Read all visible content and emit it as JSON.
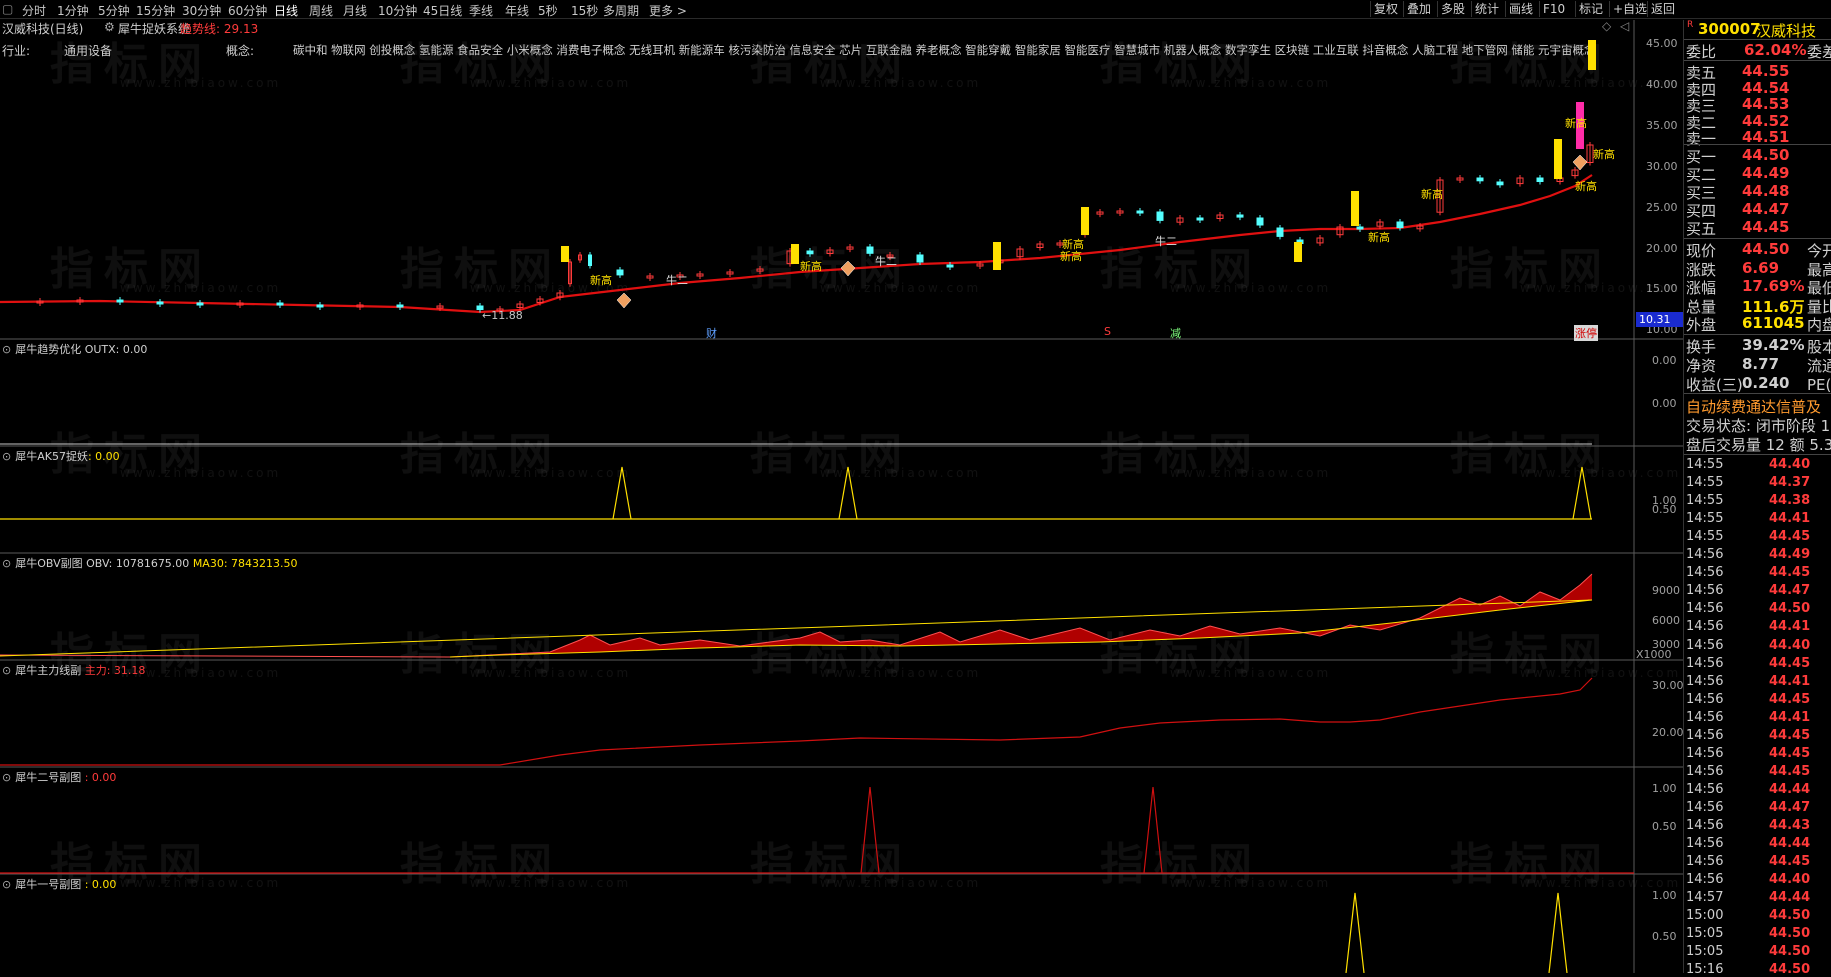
{
  "toolbar": {
    "left_items": [
      "分时",
      "1分钟",
      "5分钟",
      "15分钟",
      "30分钟",
      "60分钟",
      "日线",
      "周线",
      "月线",
      "10分钟",
      "45日线",
      "季线",
      "年线",
      "5秒",
      "15秒",
      "多周期",
      "更多 >"
    ],
    "active": "日线",
    "right_items": [
      "复权",
      "叠加",
      "多股",
      "统计",
      "画线",
      "F10",
      "标记",
      "+自选",
      "返回"
    ]
  },
  "chart_header": {
    "stock_title": "汉威科技(日线)",
    "system_name": "犀牛捉妖系统",
    "trend_label": "趋势线: 29.13"
  },
  "info_row": {
    "industry_label": "行业:",
    "industry_value": "通用设备",
    "concept_label": "概念:",
    "concepts": "碳中和 物联网 创投概念 氢能源 食品安全 小米概念 消费电子概念 无线耳机 新能源车 核污染防治 信息安全 芯片 互联金融 养老概念 智能穿戴 智能家居 智能医疗 智慧城市 机器人概念 数字孪生 区块链 工业互联 抖音概念 人脑工程 地下管网 储能 元宇宙概念"
  },
  "main_chart": {
    "price_axis": [
      "45.00",
      "40.00",
      "35.00",
      "30.00",
      "25.00",
      "20.00",
      "15.00",
      "10.00"
    ],
    "labels": {
      "low_price": "←11.88",
      "current_badge": "10.31",
      "new_high": "新高",
      "ox_two": "牛二",
      "cai": "财",
      "s_mark": "S",
      "jian": "减",
      "zhang": "涨",
      "ting": "停"
    },
    "colors": {
      "up": "#ff3b3b",
      "down": "#54ffff",
      "trend": "#e01010",
      "signal": "#ffe000",
      "limit": "#ff2ca8"
    }
  },
  "indicators": [
    {
      "name": "犀牛趋势优化",
      "value_label": "OUTX: 0.00",
      "axis": [
        "0.00",
        "0.00"
      ]
    },
    {
      "name": "犀牛AK57捉妖",
      "value_label": ": 0.00",
      "axis": [
        "1.00",
        "0.50"
      ]
    },
    {
      "name": "犀牛OBV副图",
      "value_label": "OBV: 10781675.00",
      "ma_label": "MA30: 7843213.50",
      "axis": [
        "9000",
        "6000",
        "3000",
        "X1000"
      ]
    },
    {
      "name": "犀牛主力线副",
      "value_label": "主力: 31.18",
      "axis": [
        "30.00",
        "20.00"
      ]
    },
    {
      "name": "犀牛二号副图",
      "value_label": ": 0.00",
      "axis": [
        "1.00",
        "0.50"
      ]
    },
    {
      "name": "犀牛一号副图",
      "value_label": ": 0.00",
      "axis": [
        "1.00",
        "0.50"
      ]
    }
  ],
  "watermark": {
    "brand": "指标网",
    "url": "www.zhibiaow.com"
  },
  "quote_panel": {
    "code": "300007",
    "name": "汉威科技",
    "r_mark": "R",
    "weibi_label": "委比",
    "weibi_value": "62.04%",
    "weicha_label": "委差",
    "asks": [
      {
        "label": "卖五",
        "price": "44.55"
      },
      {
        "label": "卖四",
        "price": "44.54"
      },
      {
        "label": "卖三",
        "price": "44.53"
      },
      {
        "label": "卖二",
        "price": "44.52"
      },
      {
        "label": "卖一",
        "price": "44.51"
      }
    ],
    "bids": [
      {
        "label": "买一",
        "price": "44.50"
      },
      {
        "label": "买二",
        "price": "44.49"
      },
      {
        "label": "买三",
        "price": "44.48"
      },
      {
        "label": "买四",
        "price": "44.47"
      },
      {
        "label": "买五",
        "price": "44.45"
      }
    ],
    "stats": [
      {
        "label": "现价",
        "value": "44.50",
        "extra": "今开"
      },
      {
        "label": "涨跌",
        "value": "6.69",
        "extra": "最高"
      },
      {
        "label": "涨幅",
        "value": "17.69%",
        "extra": "最低"
      },
      {
        "label": "总量",
        "value": "111.6万",
        "extra": "量比"
      },
      {
        "label": "外盘",
        "value": "611045",
        "extra": "内盘"
      }
    ],
    "stats2": [
      {
        "label": "换手",
        "value": "39.42%",
        "extra": "股本"
      },
      {
        "label": "净资",
        "value": "8.77",
        "extra": "流通"
      },
      {
        "label": "收益(三)",
        "value": "0.240",
        "extra": "PE(动)"
      }
    ],
    "notice": "自动续费通达信普及",
    "trade_status": "交易状态: 闭市阶段 1",
    "after_hours": "盘后交易量 12 额 5.3",
    "ticks": [
      {
        "time": "14:55",
        "price": "44.40"
      },
      {
        "time": "14:55",
        "price": "44.37"
      },
      {
        "time": "14:55",
        "price": "44.38"
      },
      {
        "time": "14:55",
        "price": "44.41"
      },
      {
        "time": "14:55",
        "price": "44.45"
      },
      {
        "time": "14:56",
        "price": "44.49"
      },
      {
        "time": "14:56",
        "price": "44.45"
      },
      {
        "time": "14:56",
        "price": "44.47"
      },
      {
        "time": "14:56",
        "price": "44.50"
      },
      {
        "time": "14:56",
        "price": "44.41"
      },
      {
        "time": "14:56",
        "price": "44.40"
      },
      {
        "time": "14:56",
        "price": "44.45"
      },
      {
        "time": "14:56",
        "price": "44.41"
      },
      {
        "time": "14:56",
        "price": "44.45"
      },
      {
        "time": "14:56",
        "price": "44.41"
      },
      {
        "time": "14:56",
        "price": "44.45"
      },
      {
        "time": "14:56",
        "price": "44.45"
      },
      {
        "time": "14:56",
        "price": "44.45"
      },
      {
        "time": "14:56",
        "price": "44.44"
      },
      {
        "time": "14:56",
        "price": "44.47"
      },
      {
        "time": "14:56",
        "price": "44.43"
      },
      {
        "time": "14:56",
        "price": "44.44"
      },
      {
        "time": "14:56",
        "price": "44.45"
      },
      {
        "time": "14:56",
        "price": "44.40"
      },
      {
        "time": "14:57",
        "price": "44.44"
      },
      {
        "time": "15:00",
        "price": "44.50"
      },
      {
        "time": "15:05",
        "price": "44.50"
      },
      {
        "time": "15:05",
        "price": "44.50"
      },
      {
        "time": "15:16",
        "price": "44.50"
      }
    ]
  }
}
